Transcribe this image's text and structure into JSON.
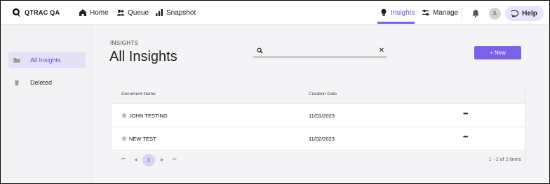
{
  "app": {
    "logo_text": "QTRAC QA"
  },
  "nav": {
    "home": "Home",
    "queue": "Queue",
    "snapshot": "Snapshot",
    "insights": "Insights",
    "manage": "Manage",
    "avatar_initials": "JL",
    "help": "Help"
  },
  "sidebar": {
    "items": [
      {
        "label": "All Insights",
        "active": true
      },
      {
        "label": "Deleted",
        "active": false
      }
    ]
  },
  "main": {
    "eyebrow": "INSIGHTS",
    "title": "All Insights",
    "search": {
      "value": "",
      "placeholder": "",
      "clear": "✕"
    },
    "new_button": "+ New"
  },
  "table": {
    "headers": {
      "name": "Document Name",
      "date": "Creation Date"
    },
    "rows": [
      {
        "name": "JOHN TESTING",
        "date": "11/01/2023",
        "more": "•••"
      },
      {
        "name": "NEW TEST",
        "date": "11/02/2023",
        "more": "•••"
      }
    ],
    "pager": {
      "first": "⏮",
      "prev": "◀",
      "current": "1",
      "next": "▶",
      "last": "⏭",
      "info": "1 - 2 of 2 items"
    }
  },
  "colors": {
    "accent": "#7b61e8",
    "accent_light": "#e4e0f8",
    "background": "#f4f4f7"
  }
}
